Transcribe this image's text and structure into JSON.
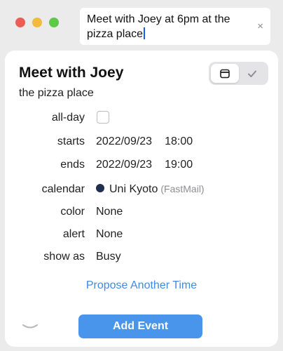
{
  "quick_entry": {
    "line1": "Meet with Joey at 6pm at the",
    "line2": "pizza place",
    "clear_glyph": "×"
  },
  "event": {
    "title": "Meet with Joey",
    "location": "the pizza place"
  },
  "fields": {
    "all_day_label": "all-day",
    "all_day_checked": false,
    "starts_label": "starts",
    "starts_date": "2022/09/23",
    "starts_time": "18:00",
    "ends_label": "ends",
    "ends_date": "2022/09/23",
    "ends_time": "19:00",
    "calendar_label": "calendar",
    "calendar_name": "Uni Kyoto",
    "calendar_account": "(FastMail)",
    "color_label": "color",
    "color_value": "None",
    "alert_label": "alert",
    "alert_value": "None",
    "show_as_label": "show as",
    "show_as_value": "Busy"
  },
  "actions": {
    "propose": "Propose Another Time",
    "add_event": "Add Event"
  },
  "colors": {
    "accent": "#4a95ec",
    "link": "#3d8be4",
    "calendar_dot": "#1f2f4f"
  },
  "icons": {
    "window_close": "close-window-icon",
    "window_minimize": "minimize-window-icon",
    "window_zoom": "zoom-window-icon",
    "calendar_view": "calendar-icon",
    "confirm": "checkmark-icon",
    "collapse": "chevron-down-icon"
  }
}
